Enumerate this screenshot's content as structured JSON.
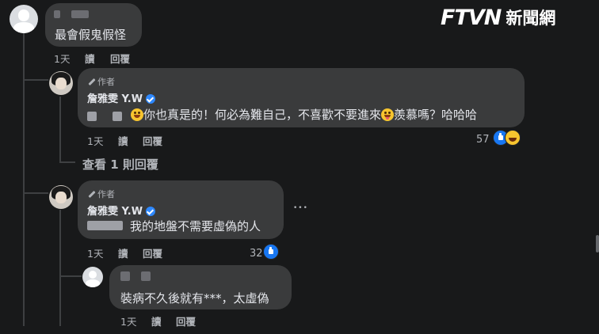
{
  "logo": {
    "ftv": "FTVN",
    "cn": "新聞網"
  },
  "comments": {
    "c1": {
      "text": "最會假鬼假怪",
      "time": "1天",
      "read": "讀",
      "reply": "回覆"
    },
    "r1": {
      "author_tag": "作者",
      "name": "詹雅雯 Y.W",
      "text_a": "你也真是的！何必為難自己，不喜歡不要進來",
      "text_b": "羨慕嗎？哈哈哈",
      "time": "1天",
      "read": "讀",
      "reply": "回覆",
      "reactions": "57"
    },
    "view_replies": "查看 1 則回覆",
    "r2": {
      "author_tag": "作者",
      "name": "詹雅雯 Y.W",
      "text": "我的地盤不需要虛偽的人",
      "time": "1天",
      "read": "讀",
      "reply": "回覆",
      "reactions": "32",
      "more": "•••"
    },
    "r3": {
      "text": "裝病不久後就有***，太虛偽",
      "time": "1天",
      "read": "讀",
      "reply": "回覆"
    }
  },
  "colors": {
    "background": "#18191a",
    "bubble": "#3a3b3c",
    "text": "#e4e6eb",
    "muted": "#b0b3b8",
    "verified": "#2d88ff",
    "like": "#1877f2"
  },
  "icons": [
    "pen-icon",
    "verified-badge-icon",
    "laughing-emoji-icon",
    "grin-emoji-icon",
    "like-reaction-icon",
    "haha-reaction-icon",
    "more-options-icon",
    "default-avatar-icon"
  ]
}
